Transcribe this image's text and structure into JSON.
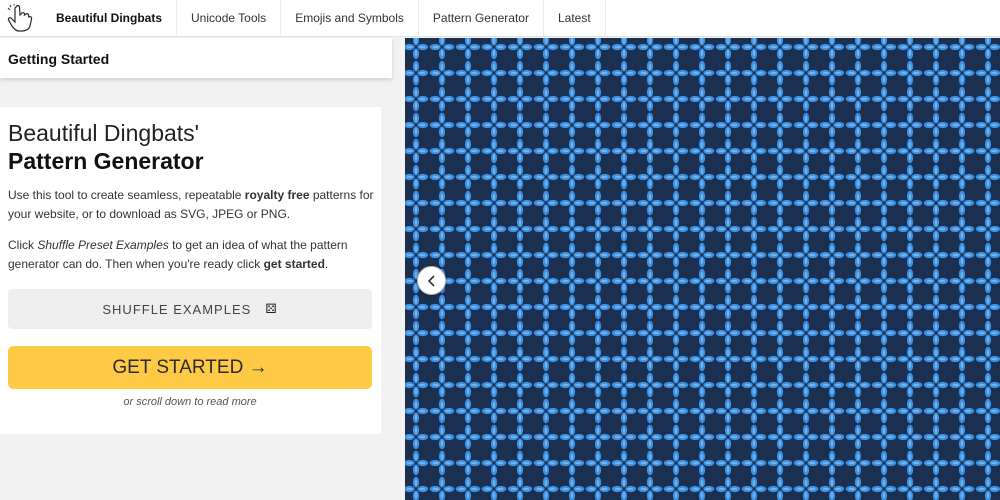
{
  "nav": {
    "logo_icon": "hand-pointer-icon",
    "brand": "Beautiful Dingbats",
    "items": [
      {
        "label": "Unicode Tools"
      },
      {
        "label": "Emojis and Symbols"
      },
      {
        "label": "Pattern Generator"
      },
      {
        "label": "Latest"
      }
    ]
  },
  "sidebar": {
    "getting_started": "Getting Started"
  },
  "intro": {
    "title_line1": "Beautiful Dingbats'",
    "title_line2": "Pattern Generator",
    "p1_before": "Use this tool to create seamless, repeatable ",
    "p1_bold": "royalty free",
    "p1_after": " patterns for your website, or to download as SVG, JPEG or PNG.",
    "p2_before": "Click ",
    "p2_italic": "Shuffle Preset Examples",
    "p2_middle": " to get an idea of what the pattern generator can do. Then when you're ready click ",
    "p2_bold": "get started",
    "p2_after": ".",
    "shuffle_label": "SHUFFLE EXAMPLES",
    "dice_glyph": "⚄",
    "start_label": "GET STARTED →",
    "scroll_note": "or scroll down to read more"
  },
  "pattern": {
    "background": "#1b3050",
    "petal_color": "#3d8fe0",
    "petal_highlight": "#6ab4f5"
  },
  "colors": {
    "accent_yellow": "#fec945",
    "button_gray": "#eeeeee"
  }
}
